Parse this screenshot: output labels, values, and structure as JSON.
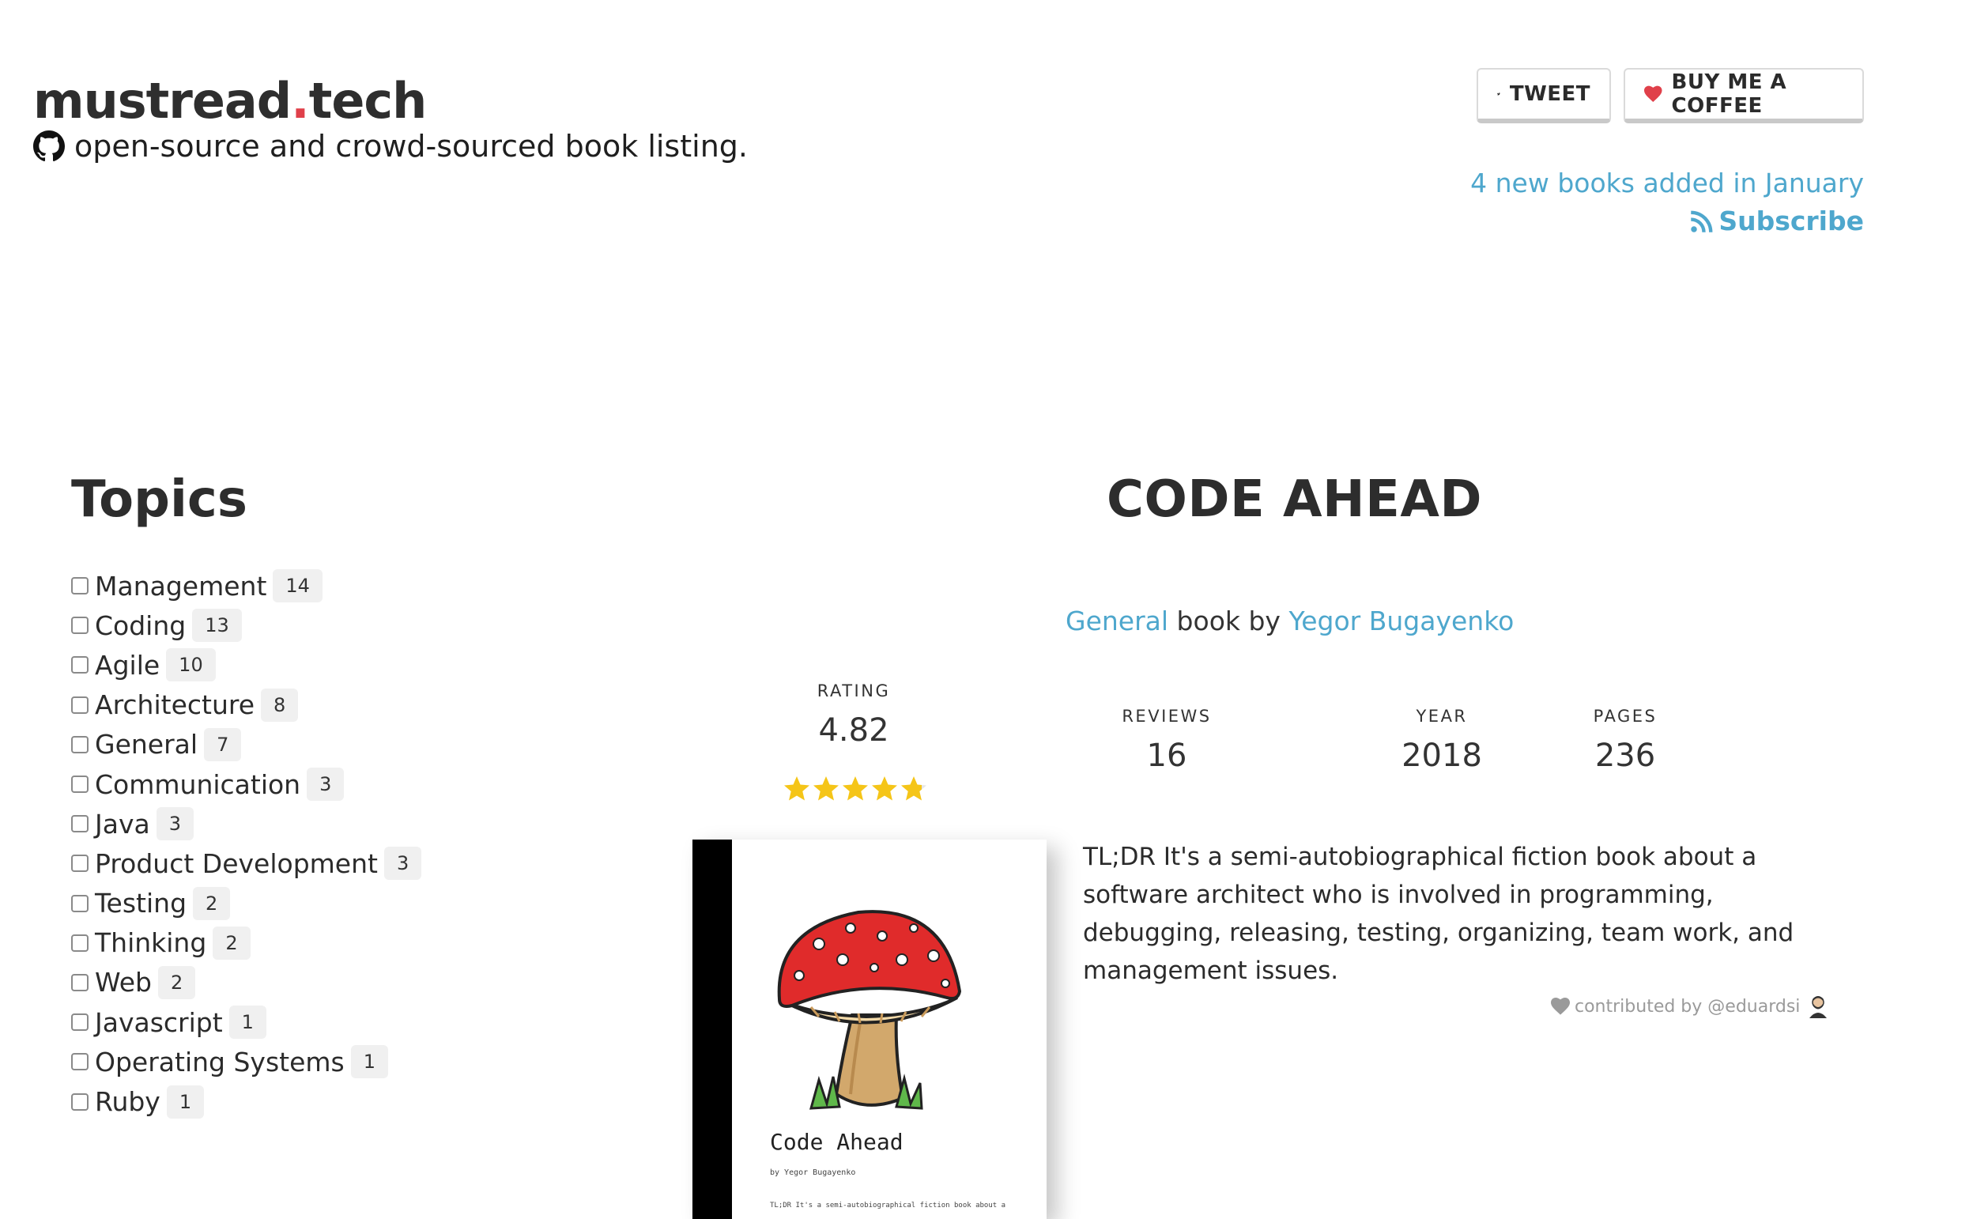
{
  "site": {
    "name_main": "mustread",
    "name_dot": ".",
    "name_tld": "tech",
    "tagline": "open-source and crowd-sourced book listing."
  },
  "header": {
    "tweet_label": "TWEET",
    "coffee_label": "BUY ME A COFFEE",
    "new_books": "4 new books added in January",
    "subscribe_label": "Subscribe"
  },
  "topics": {
    "title": "Topics",
    "items": [
      {
        "label": "Management",
        "count": "14"
      },
      {
        "label": "Coding",
        "count": "13"
      },
      {
        "label": "Agile",
        "count": "10"
      },
      {
        "label": "Architecture",
        "count": "8"
      },
      {
        "label": "General",
        "count": "7"
      },
      {
        "label": "Communication",
        "count": "3"
      },
      {
        "label": "Java",
        "count": "3"
      },
      {
        "label": "Product Development",
        "count": "3"
      },
      {
        "label": "Testing",
        "count": "2"
      },
      {
        "label": "Thinking",
        "count": "2"
      },
      {
        "label": "Web",
        "count": "2"
      },
      {
        "label": "Javascript",
        "count": "1"
      },
      {
        "label": "Operating Systems",
        "count": "1"
      },
      {
        "label": "Ruby",
        "count": "1"
      }
    ]
  },
  "book": {
    "title": "CODE AHEAD",
    "category": "General",
    "by_text": " book by ",
    "author": "Yegor Bugayenko",
    "rating_label": "RATING",
    "rating_value": "4.82",
    "rating_stars": 4.82,
    "rating_max": 5,
    "reviews_label": "REVIEWS",
    "reviews_value": "16",
    "year_label": "YEAR",
    "year_value": "2018",
    "pages_label": "PAGES",
    "pages_value": "236",
    "cover_title": "Code Ahead",
    "cover_author": "by Yegor Bugayenko",
    "cover_text": "TL;DR It's a semi-autobiographical fiction book about a",
    "description": "TL;DR It's a semi-autobiographical fiction book about a software architect who is involved in programming, debugging, releasing, testing, organizing, team work, and management issues.",
    "contributed": "contributed by @eduardsi"
  },
  "colors": {
    "accent": "#4ea7cd",
    "logo_dot": "#e0404a",
    "star": "#f5c518",
    "heart": "#e0404a"
  }
}
